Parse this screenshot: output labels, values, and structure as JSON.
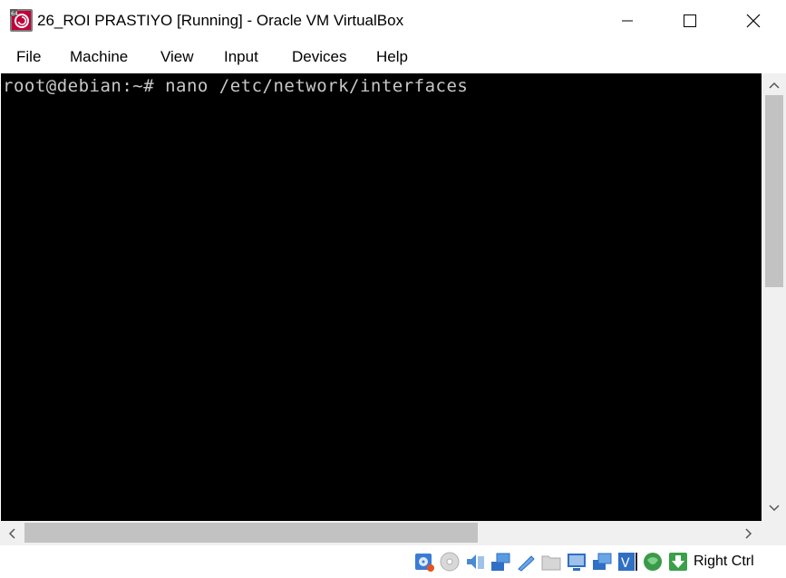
{
  "window": {
    "title": "26_ROI PRASTIYO [Running] - Oracle VM VirtualBox"
  },
  "menu": {
    "items": [
      {
        "label": "File"
      },
      {
        "label": "Machine"
      },
      {
        "label": "View"
      },
      {
        "label": "Input"
      },
      {
        "label": "Devices"
      },
      {
        "label": "Help"
      }
    ]
  },
  "terminal": {
    "line": "root@debian:~# nano /etc/network/interfaces"
  },
  "statusbar": {
    "host_key": "Right Ctrl",
    "icons": [
      "hard-disk-icon",
      "optical-drive-icon",
      "audio-icon",
      "network-icon",
      "usb-icon",
      "shared-folders-icon",
      "display-icon",
      "video-capture-icon",
      "virtualization-icon",
      "mouse-integration-icon",
      "keyboard-capture-icon"
    ]
  },
  "colors": {
    "screen_bg": "#000000",
    "terminal_text": "#c8c8c8",
    "scrollbar_track": "#f0f0f0",
    "scrollbar_thumb": "#c2c2c2"
  }
}
